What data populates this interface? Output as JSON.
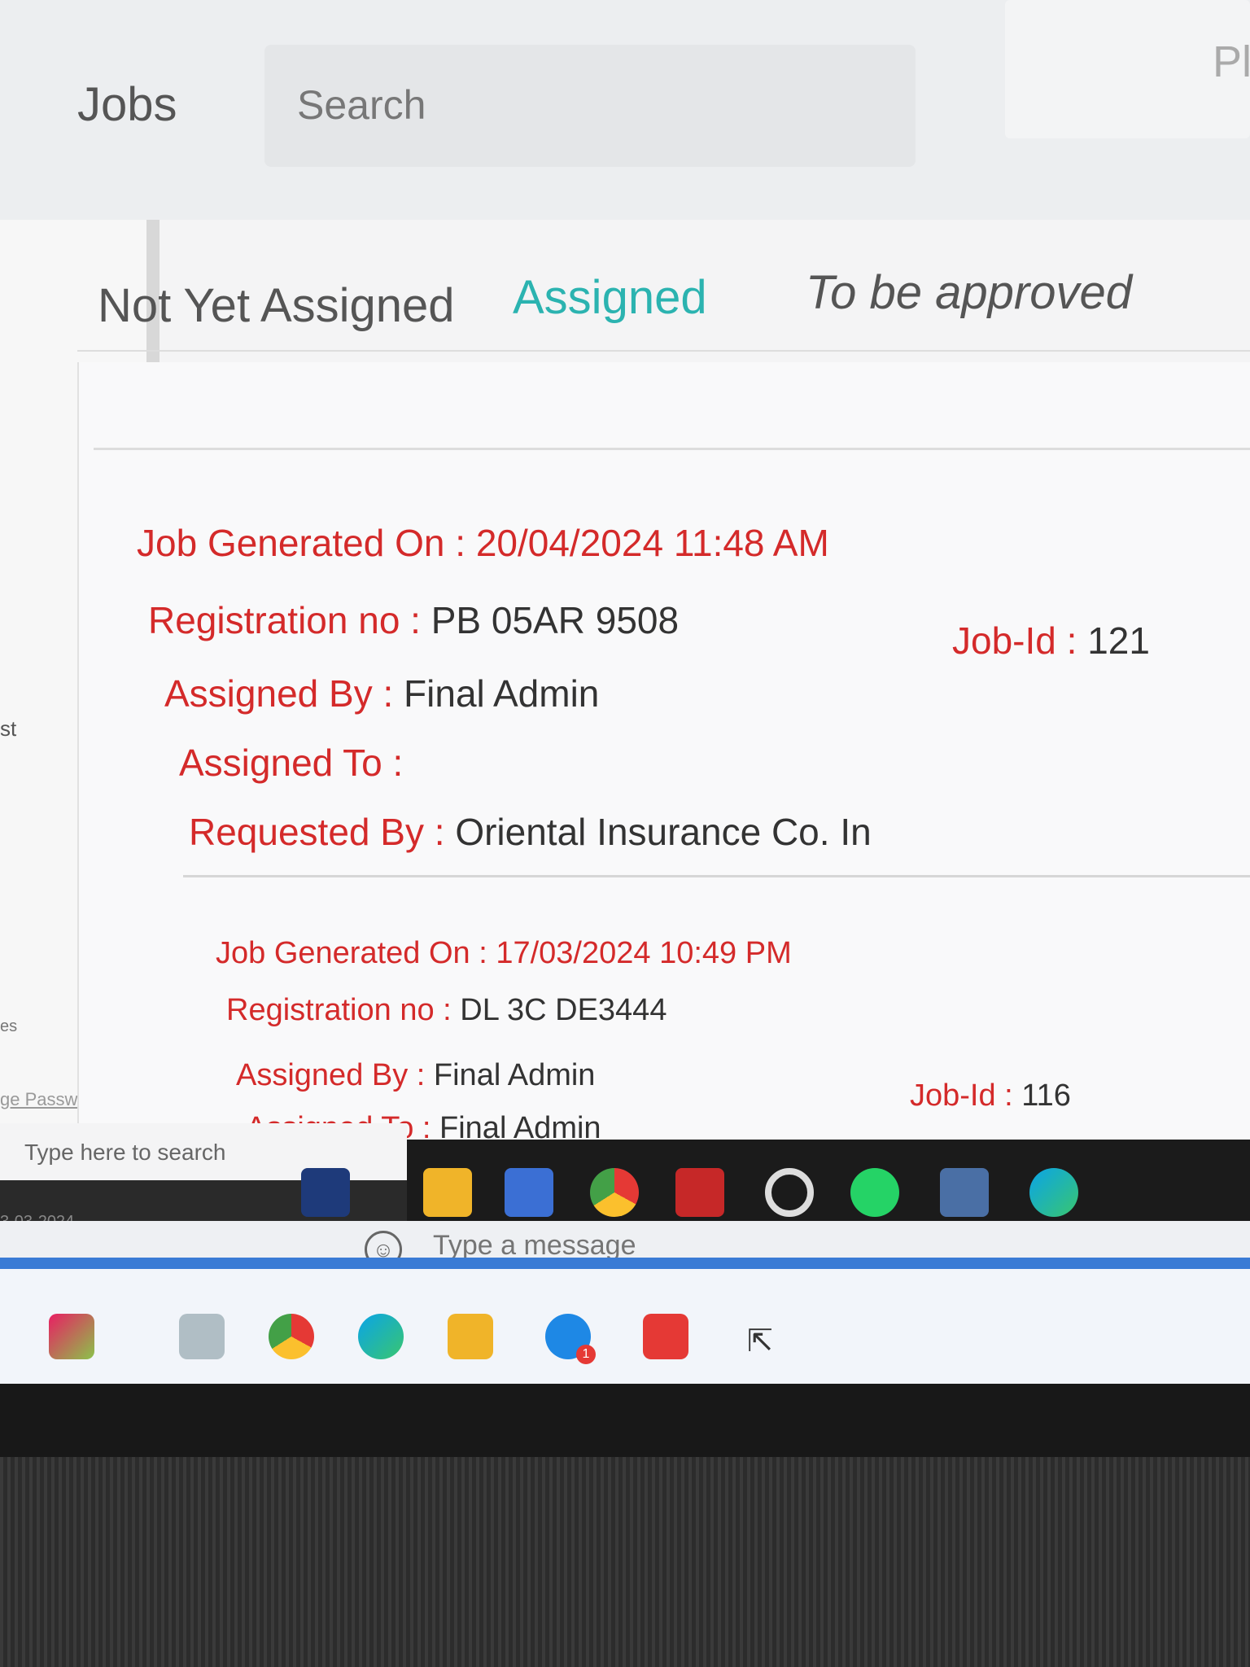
{
  "header": {
    "title": "Jobs",
    "search_placeholder": "Search",
    "right_partial": "Pl"
  },
  "tabs": [
    {
      "label": "Not Yet Assigned",
      "active": false
    },
    {
      "label": "Assigned",
      "active": true
    },
    {
      "label": "To be approved",
      "active": false
    }
  ],
  "jobs": [
    {
      "generated_label": "Job Generated On : ",
      "generated_value": "20/04/2024 11:48 AM",
      "reg_label": "Registration no : ",
      "reg_value": "PB 05AR 9508",
      "job_id_label": "Job-Id : ",
      "job_id_value": "121",
      "assigned_by_label": "Assigned By : ",
      "assigned_by_value": "Final Admin",
      "assigned_to_label": "Assigned To : ",
      "assigned_to_value": "",
      "requested_by_label": "Requested By : ",
      "requested_by_value": "Oriental Insurance Co. In"
    },
    {
      "generated_label": "Job Generated On : ",
      "generated_value": "17/03/2024 10:49 PM",
      "reg_label": "Registration no : ",
      "reg_value": "DL 3C DE3444",
      "job_id_label": "Job-Id : ",
      "job_id_value": "116",
      "assigned_by_label": "Assigned By : ",
      "assigned_by_value": "Final Admin",
      "assigned_to_label": "Assigned To : ",
      "assigned_to_value": "Final Admin"
    }
  ],
  "sidebar_fragments": {
    "st": "st",
    "es": "es",
    "password": "ge Password",
    "date": "3-03-2024"
  },
  "taskbar": {
    "search_placeholder": "Type here to search",
    "icons": [
      "bird-icon",
      "file-explorer-icon",
      "calculator-icon",
      "chrome-icon",
      "anchor-app-icon",
      "ring-app-icon",
      "whatsapp-icon",
      "photo-app-icon",
      "edge-icon"
    ]
  },
  "message_bar": {
    "placeholder": "Type a message"
  },
  "bottom_taskbar": {
    "icons": [
      "colorful-app-icon",
      "image-app-icon",
      "chrome-icon",
      "edge-icon",
      "folder-icon",
      "skype-icon",
      "red-app-icon"
    ],
    "skype_badge": "1"
  },
  "colors": {
    "accent": "#2bb3b0",
    "label_red": "#d42a2a",
    "text": "#333333"
  }
}
